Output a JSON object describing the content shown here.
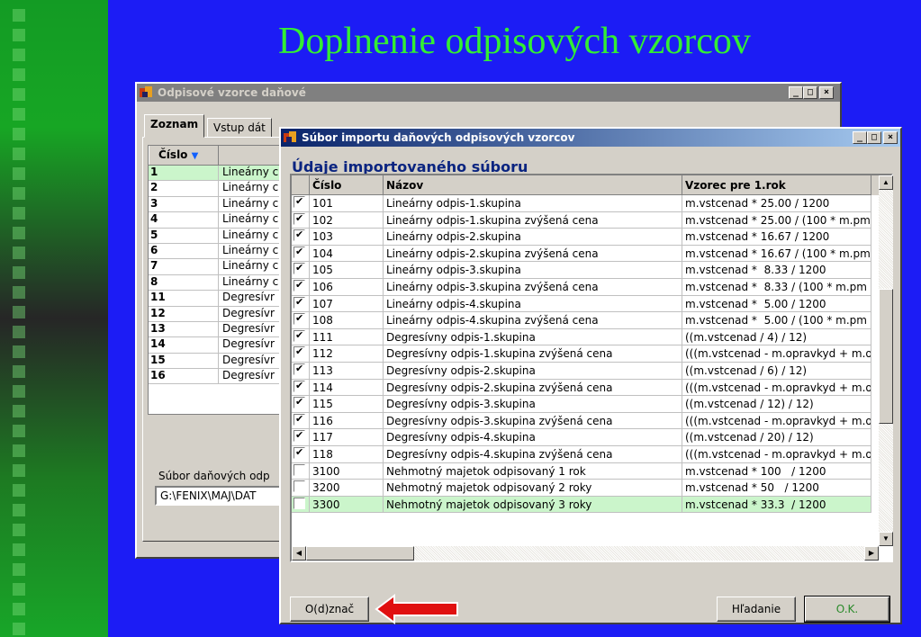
{
  "slide": {
    "title": "Doplnenie odpisových vzorcov"
  },
  "back_window": {
    "title": "Odpisové vzorce daňové",
    "tabs": [
      "Zoznam",
      "Vstup dát"
    ],
    "column_header": "Číslo",
    "rows": [
      {
        "num": "1",
        "name": "Lineárny c"
      },
      {
        "num": "2",
        "name": "Lineárny c"
      },
      {
        "num": "3",
        "name": "Lineárny c"
      },
      {
        "num": "4",
        "name": "Lineárny c"
      },
      {
        "num": "5",
        "name": "Lineárny c"
      },
      {
        "num": "6",
        "name": "Lineárny c"
      },
      {
        "num": "7",
        "name": "Lineárny c"
      },
      {
        "num": "8",
        "name": "Lineárny c"
      },
      {
        "num": "11",
        "name": "Degresívr"
      },
      {
        "num": "12",
        "name": "Degresívr"
      },
      {
        "num": "13",
        "name": "Degresívr"
      },
      {
        "num": "14",
        "name": "Degresívr"
      },
      {
        "num": "15",
        "name": "Degresívr"
      },
      {
        "num": "16",
        "name": "Degresívr"
      }
    ],
    "file_label": "Súbor daňových odp",
    "file_path": "G:\\FENIX\\MAJ\\DAT"
  },
  "import_dialog": {
    "title": "Súbor importu daňových odpisových vzorcov",
    "section_label": "Údaje importovaného súboru",
    "columns": [
      "Číslo",
      "Názov",
      "Vzorec pre 1.rok"
    ],
    "rows": [
      {
        "checked": true,
        "num": "101",
        "name": "Lineárny odpis-1.skupina",
        "formula": "m.vstcenad * 25.00 / 1200"
      },
      {
        "checked": true,
        "num": "102",
        "name": "Lineárny odpis-1.skupina zvýšená cena",
        "formula": "m.vstcenad * 25.00 / (100 * m.pm"
      },
      {
        "checked": true,
        "num": "103",
        "name": "Lineárny odpis-2.skupina",
        "formula": "m.vstcenad * 16.67 / 1200"
      },
      {
        "checked": true,
        "num": "104",
        "name": "Lineárny odpis-2.skupina zvýšená cena",
        "formula": "m.vstcenad * 16.67 / (100 * m.pm"
      },
      {
        "checked": true,
        "num": "105",
        "name": "Lineárny odpis-3.skupina",
        "formula": "m.vstcenad *  8.33 / 1200"
      },
      {
        "checked": true,
        "num": "106",
        "name": "Lineárny odpis-3.skupina zvýšená cena",
        "formula": "m.vstcenad *  8.33 / (100 * m.pm"
      },
      {
        "checked": true,
        "num": "107",
        "name": "Lineárny odpis-4.skupina",
        "formula": "m.vstcenad *  5.00 / 1200"
      },
      {
        "checked": true,
        "num": "108",
        "name": "Lineárny odpis-4.skupina zvýšená cena",
        "formula": "m.vstcenad *  5.00 / (100 * m.pm"
      },
      {
        "checked": true,
        "num": "111",
        "name": "Degresívny odpis-1.skupina",
        "formula": "((m.vstcenad / 4) / 12)"
      },
      {
        "checked": true,
        "num": "112",
        "name": "Degresívny odpis-1.skupina zvýšená cena",
        "formula": "(((m.vstcenad - m.opravkyd + m.o"
      },
      {
        "checked": true,
        "num": "113",
        "name": "Degresívny odpis-2.skupina",
        "formula": "((m.vstcenad / 6) / 12)"
      },
      {
        "checked": true,
        "num": "114",
        "name": "Degresívny odpis-2.skupina zvýšená cena",
        "formula": "(((m.vstcenad - m.opravkyd + m.o"
      },
      {
        "checked": true,
        "num": "115",
        "name": "Degresívny odpis-3.skupina",
        "formula": "((m.vstcenad / 12) / 12)"
      },
      {
        "checked": true,
        "num": "116",
        "name": "Degresívny odpis-3.skupina zvýšená cena",
        "formula": "(((m.vstcenad - m.opravkyd + m.o"
      },
      {
        "checked": true,
        "num": "117",
        "name": "Degresívny odpis-4.skupina",
        "formula": "((m.vstcenad / 20) / 12)"
      },
      {
        "checked": true,
        "num": "118",
        "name": "Degresívny odpis-4.skupina zvýšená cena",
        "formula": "(((m.vstcenad - m.opravkyd + m.o"
      },
      {
        "checked": false,
        "num": "3100",
        "name": "Nehmotný majetok odpisovaný 1 rok",
        "formula": "m.vstcenad * 100   / 1200"
      },
      {
        "checked": false,
        "num": "3200",
        "name": "Nehmotný majetok odpisovaný 2 roky",
        "formula": "m.vstcenad * 50   / 1200"
      },
      {
        "checked": false,
        "num": "3300",
        "name": "Nehmotný majetok odpisovaný 3 roky",
        "formula": "m.vstcenad * 33.3  / 1200"
      }
    ],
    "buttons": {
      "mark": "O(d)znač",
      "search": "Hľadanie",
      "ok": "O.K."
    }
  },
  "colors": {
    "slide_bg": "#1c1cf5",
    "title": "#33ee33",
    "selected_row": "#cbf5cb",
    "arrow": "#e01010"
  }
}
